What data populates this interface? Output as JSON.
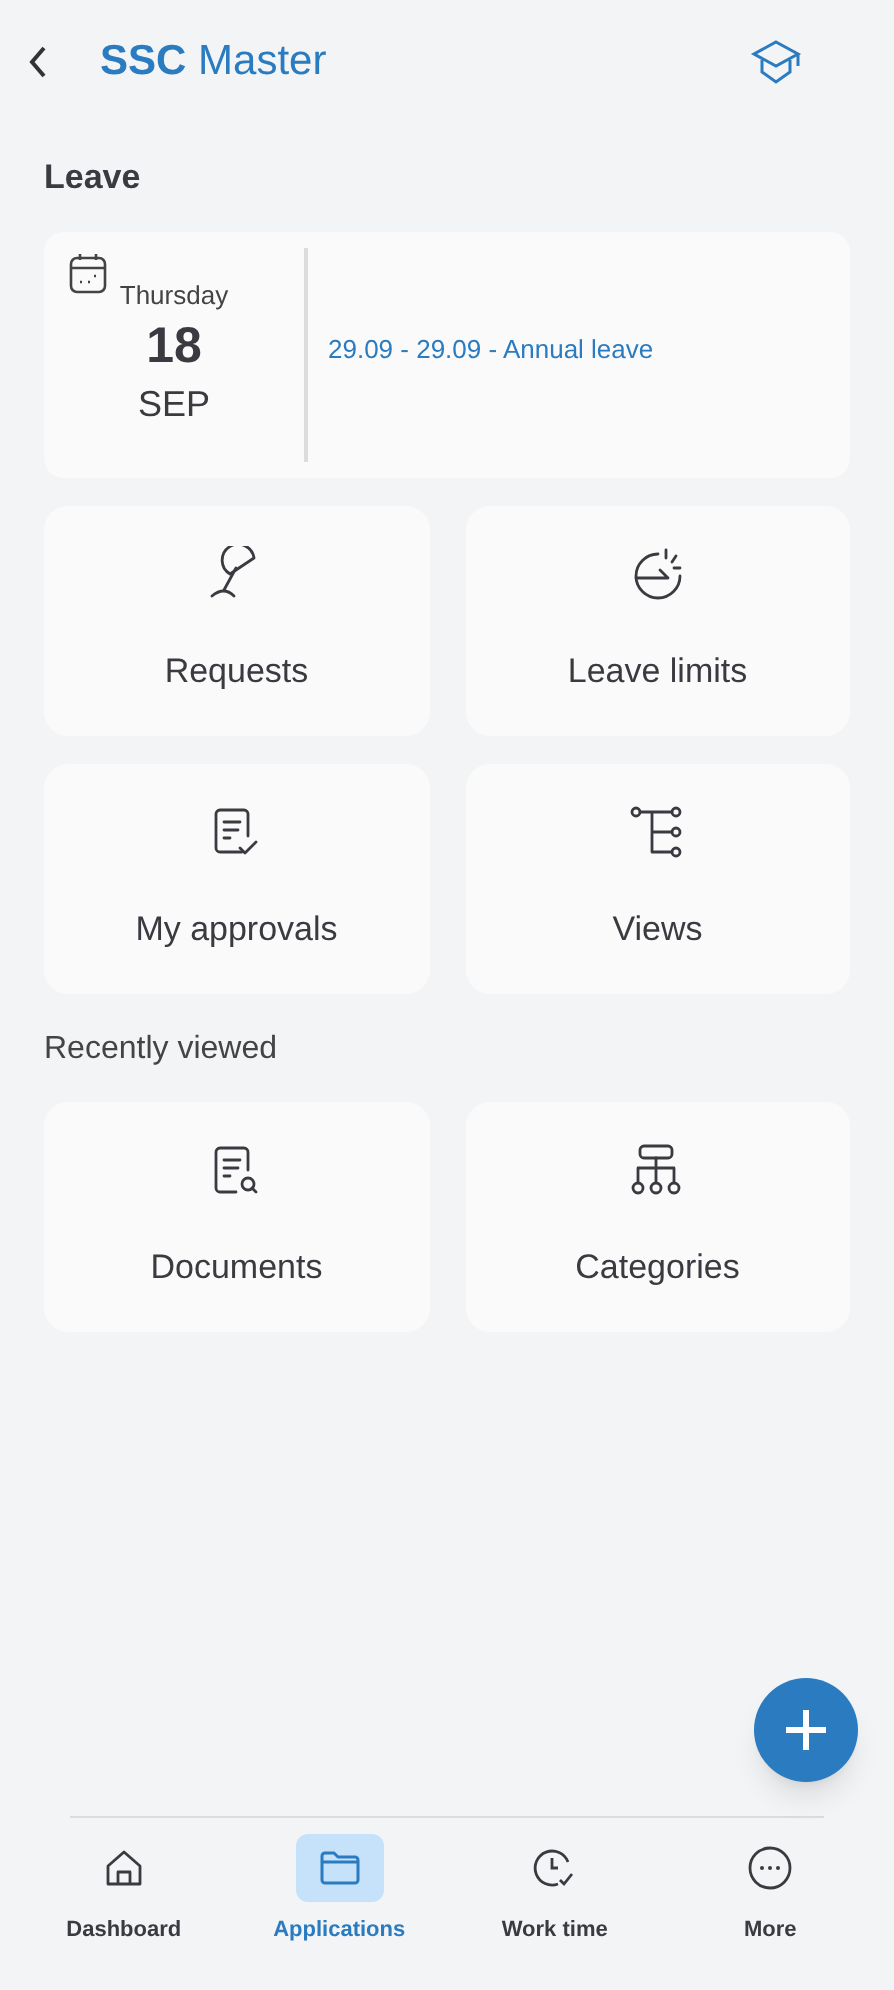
{
  "header": {
    "title": "**SSC** Master"
  },
  "leave": {
    "heading": "Leave",
    "weekday": "Thursday",
    "day": "18",
    "month": "SEP",
    "entry": "29.09 - 29.09 - Annual leave"
  },
  "tiles": [
    {
      "label": "Requests"
    },
    {
      "label": "Leave limits"
    },
    {
      "label": "My approvals"
    },
    {
      "label": "Views"
    }
  ],
  "recent": {
    "heading": "Recently viewed",
    "tiles": [
      {
        "label": "Documents"
      },
      {
        "label": "Categories"
      }
    ]
  },
  "nav": [
    {
      "label": "Dashboard",
      "selected": false
    },
    {
      "label": "Applications",
      "selected": true
    },
    {
      "label": "Work time",
      "selected": false
    },
    {
      "label": "More",
      "selected": false
    }
  ]
}
